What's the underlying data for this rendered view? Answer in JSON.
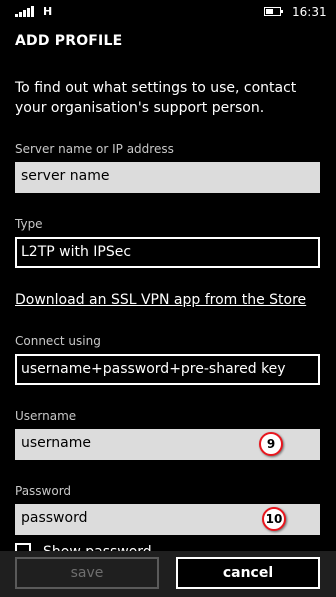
{
  "status_bar": {
    "network_type": "H",
    "time": "16:31",
    "battery_level_fraction": 0.55,
    "signal_bars": 5
  },
  "page": {
    "title": "ADD PROFILE",
    "intro": "To find out what settings to use, contact your organisation's support person."
  },
  "server": {
    "label": "Server name or IP address",
    "value": "server name"
  },
  "type": {
    "label": "Type",
    "value": "L2TP with IPSec"
  },
  "store_link": "Download an SSL VPN app from the Store",
  "connect_using": {
    "label": "Connect using",
    "value": "username+password+pre-shared key"
  },
  "username": {
    "label": "Username",
    "value": "username",
    "marker": "9"
  },
  "password": {
    "label": "Password",
    "value": "password",
    "marker": "10"
  },
  "show_password": {
    "label": "Show password",
    "checked": false
  },
  "app_bar": {
    "save_label": "save",
    "cancel_label": "cancel"
  },
  "colors": {
    "background": "#000000",
    "field_fill": "#dcdcdc",
    "marker_border": "#e8161e",
    "app_bar": "#1f1f1f"
  }
}
